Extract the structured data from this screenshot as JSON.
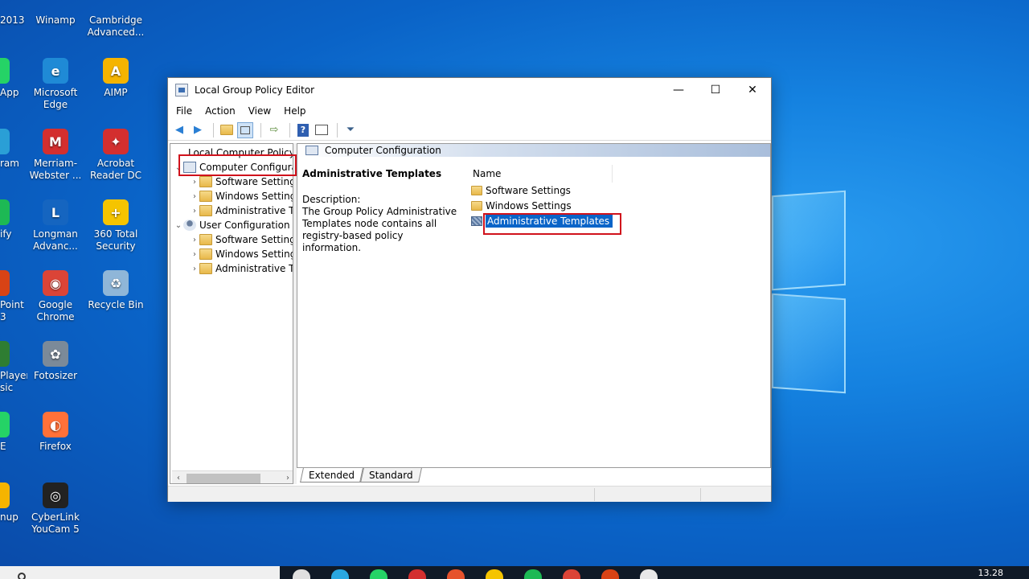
{
  "desktop": {
    "icons": [
      {
        "id": "partial-2013",
        "label": "2013",
        "color": "#c0392b",
        "glyph": ""
      },
      {
        "id": "winamp",
        "label": "Winamp",
        "color": "#d4a017",
        "glyph": "⚡"
      },
      {
        "id": "cambridge",
        "label": "Cambridge Advanced...",
        "color": "#2e7d32",
        "glyph": "C"
      },
      {
        "id": "partial-app",
        "label": "App",
        "color": "#25d366",
        "glyph": ""
      },
      {
        "id": "edge",
        "label": "Microsoft Edge",
        "color": "#1f8ad6",
        "glyph": "e"
      },
      {
        "id": "aimp",
        "label": "AIMP",
        "color": "#f5b400",
        "glyph": "A"
      },
      {
        "id": "partial-ram",
        "label": "ram",
        "color": "#2a9fd6",
        "glyph": ""
      },
      {
        "id": "merriam",
        "label": "Merriam-Webster ...",
        "color": "#d32f2f",
        "glyph": "M"
      },
      {
        "id": "acrobat",
        "label": "Acrobat Reader DC",
        "color": "#d32f2f",
        "glyph": "✦"
      },
      {
        "id": "partial-ify",
        "label": "ify",
        "color": "#1db954",
        "glyph": ""
      },
      {
        "id": "longman",
        "label": "Longman Advanc...",
        "color": "#1565c0",
        "glyph": "L"
      },
      {
        "id": "360",
        "label": "360 Total Security",
        "color": "#f5c400",
        "glyph": "+"
      },
      {
        "id": "partial-point",
        "label": "Point 3",
        "color": "#d84315",
        "glyph": ""
      },
      {
        "id": "chrome",
        "label": "Google Chrome",
        "color": "#db4437",
        "glyph": "◉"
      },
      {
        "id": "recycle",
        "label": "Recycle Bin",
        "color": "#8fb6d8",
        "glyph": "♻"
      },
      {
        "id": "partial-player",
        "label": "Player sic",
        "color": "#2e7d32",
        "glyph": ""
      },
      {
        "id": "fotosizer",
        "label": "Fotosizer",
        "color": "#7b8a99",
        "glyph": "✿"
      },
      {
        "id": "partial-e",
        "label": "E",
        "color": "#25d366",
        "glyph": ""
      },
      {
        "id": "firefox",
        "label": "Firefox",
        "color": "#ff7139",
        "glyph": "◐"
      },
      {
        "id": "partial-nup",
        "label": "nup",
        "color": "#f5b400",
        "glyph": ""
      },
      {
        "id": "youcam",
        "label": "CyberLink YouCam 5",
        "color": "#222222",
        "glyph": "◎"
      }
    ]
  },
  "window": {
    "title": "Local Group Policy Editor",
    "controls": {
      "minimize": "—",
      "maximize": "☐",
      "close": "✕"
    },
    "menu": [
      "File",
      "Action",
      "View",
      "Help"
    ],
    "tree": {
      "root": "Local Computer Policy",
      "computer": "Computer Configura",
      "computer_children": [
        "Software Settings",
        "Windows Setting",
        "Administrative Te"
      ],
      "user": "User Configuration",
      "user_children": [
        "Software Settings",
        "Windows Setting",
        "Administrative Te"
      ]
    },
    "right": {
      "header": "Computer Configuration",
      "desc_title": "Administrative Templates",
      "desc_label": "Description:",
      "desc_text": "The Group Policy Administrative Templates node contains all registry-based policy information.",
      "column": "Name",
      "items": [
        "Software Settings",
        "Windows Settings",
        "Administrative Templates"
      ]
    },
    "tabs": [
      "Extended",
      "Standard"
    ]
  },
  "taskbar": {
    "clock": "13.28",
    "apps": [
      "#e0e0e0",
      "#2aa7e0",
      "#25d366",
      "#d32f2f",
      "#e6522c",
      "#f5c400",
      "#1db954",
      "#db4437",
      "#d84315",
      "#e8e8e8"
    ]
  }
}
